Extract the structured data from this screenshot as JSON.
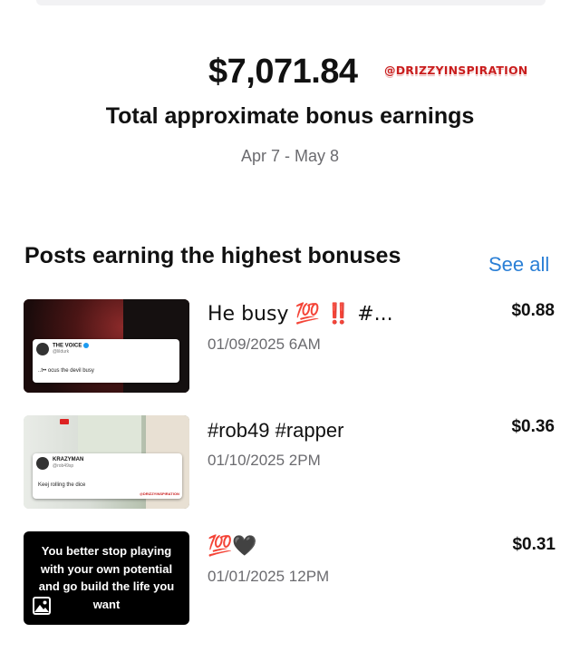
{
  "summary": {
    "total_amount": "$7,071.84",
    "watermark": "@DRIZZYINSPIRATION",
    "subtitle": "Total approximate bonus earnings",
    "date_range": "Apr 7 - May 8"
  },
  "section": {
    "title": "Posts earning the highest bonuses",
    "see_all_label": "See all"
  },
  "posts": [
    {
      "title": "He busy 💯 ‼️ #...",
      "date": "01/09/2025 6AM",
      "earnings": "$0.88",
      "thumbnail": {
        "tweet_name": "THE VOICE",
        "tweet_handle": "@lildurk",
        "tweet_text": "..t•• ocus the devil busy"
      }
    },
    {
      "title": "#rob49 #rapper",
      "date": "01/10/2025 2PM",
      "earnings": "$0.36",
      "thumbnail": {
        "tweet_name": "KRAZYMAN",
        "tweet_handle": "@rob49sp",
        "tweet_text": "Keej rolling the dice",
        "watermark": "@DRIZZYINSPIRATION"
      }
    },
    {
      "title": "💯🖤",
      "date": "01/01/2025 12PM",
      "earnings": "$0.31",
      "thumbnail": {
        "quote": "You better stop playing with your own potential and go build the life you want",
        "icon": "image-icon"
      }
    }
  ],
  "colors": {
    "link": "#2a7fd6",
    "secondary_text": "#6b6b6f",
    "watermark": "#c91d1d"
  }
}
